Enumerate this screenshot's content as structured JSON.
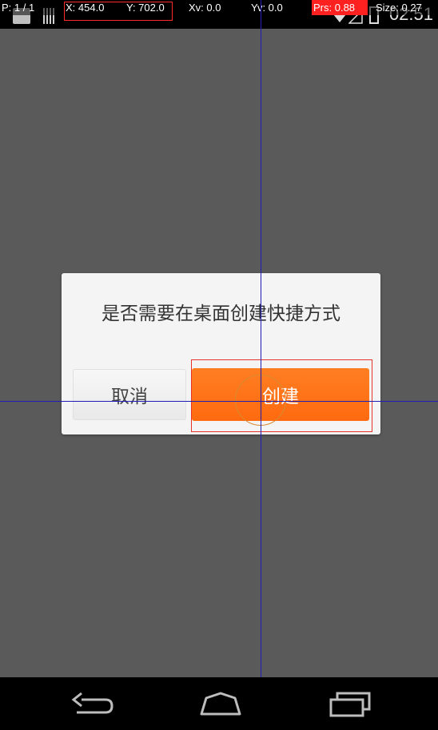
{
  "status_bar": {
    "time": "02:51",
    "icons": [
      "notification-icon",
      "barcode-icon",
      "wifi-icon",
      "signal-icon",
      "battery-icon"
    ]
  },
  "pointer_overlay": {
    "p": "P: 1 / 1",
    "x": "X: 454.0",
    "y": "Y: 702.0",
    "xv": "Xv: 0.0",
    "yv": "Yv: 0.0",
    "prs": "Prs: 0.88",
    "size": "Size: 0.27",
    "prs_color": "#ff2020"
  },
  "dialog": {
    "message": "是否需要在桌面创建快捷方式",
    "cancel_label": "取消",
    "create_label": "创建",
    "accent_color": "#ff7418"
  },
  "nav_bar": {
    "back_icon": "back-icon",
    "home_icon": "home-icon",
    "recents_icon": "recents-icon"
  }
}
